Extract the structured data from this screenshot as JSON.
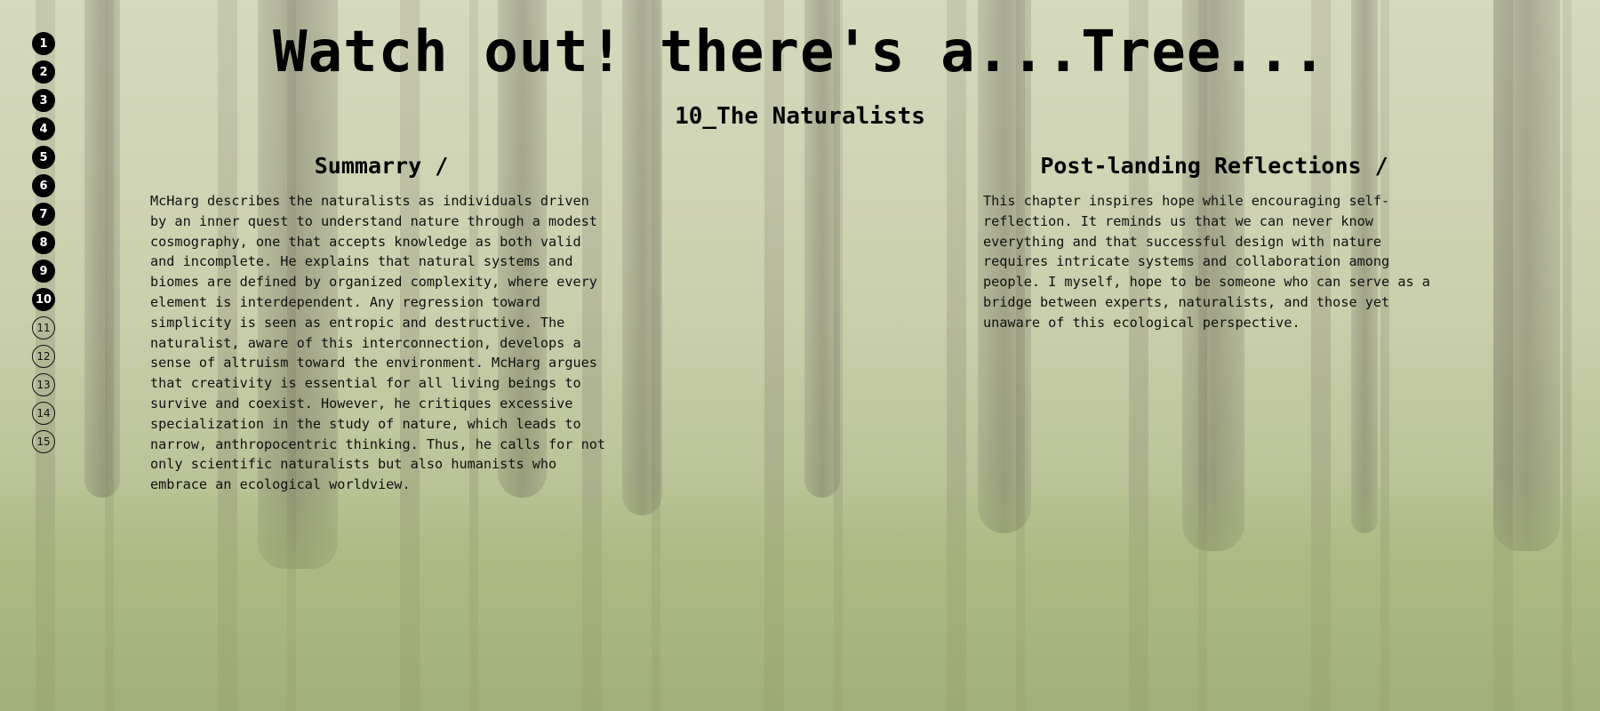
{
  "header": {
    "title": "Watch out! there's a...Tree...",
    "chapter_title": "10_The Naturalists"
  },
  "chapter_nav": {
    "current": "10",
    "items": [
      {
        "label": "1",
        "state": "visited"
      },
      {
        "label": "2",
        "state": "visited"
      },
      {
        "label": "3",
        "state": "visited"
      },
      {
        "label": "4",
        "state": "visited"
      },
      {
        "label": "5",
        "state": "visited"
      },
      {
        "label": "6",
        "state": "visited"
      },
      {
        "label": "7",
        "state": "visited"
      },
      {
        "label": "8",
        "state": "visited"
      },
      {
        "label": "9",
        "state": "visited"
      },
      {
        "label": "10",
        "state": "current"
      },
      {
        "label": "11",
        "state": "unvisited"
      },
      {
        "label": "12",
        "state": "unvisited"
      },
      {
        "label": "13",
        "state": "unvisited"
      },
      {
        "label": "14",
        "state": "unvisited"
      },
      {
        "label": "15",
        "state": "unvisited"
      }
    ]
  },
  "summary": {
    "heading": "Summarry /",
    "body": "McHarg describes the naturalists as individuals driven by an inner quest to understand nature through a modest cosmography, one that accepts knowledge as both valid and incomplete. He explains that natural systems and biomes are defined by organized complexity, where every element is interdependent. Any regression toward simplicity is seen as entropic and destructive. The naturalist, aware of this interconnection, develops a sense of altruism toward the environment. McHarg argues that creativity is essential for all living beings to survive and coexist. However, he critiques excessive specialization in the study of nature, which leads to narrow, anthropocentric thinking. Thus, he calls for not only scientific naturalists but also humanists who embrace an ecological worldview."
  },
  "reflections": {
    "heading": "Post-landing Reflections /",
    "body": "This chapter inspires hope while encouraging self-reflection. It reminds us that we can never know everything and that successful design with nature requires intricate systems and collaboration among people. I myself, hope to be someone who can serve as a bridge between experts, naturalists, and those yet unaware of this ecological perspective."
  },
  "colors": {
    "text": "#111111",
    "nav_filled": "#000000",
    "background_tint": "#c9ccb4"
  }
}
